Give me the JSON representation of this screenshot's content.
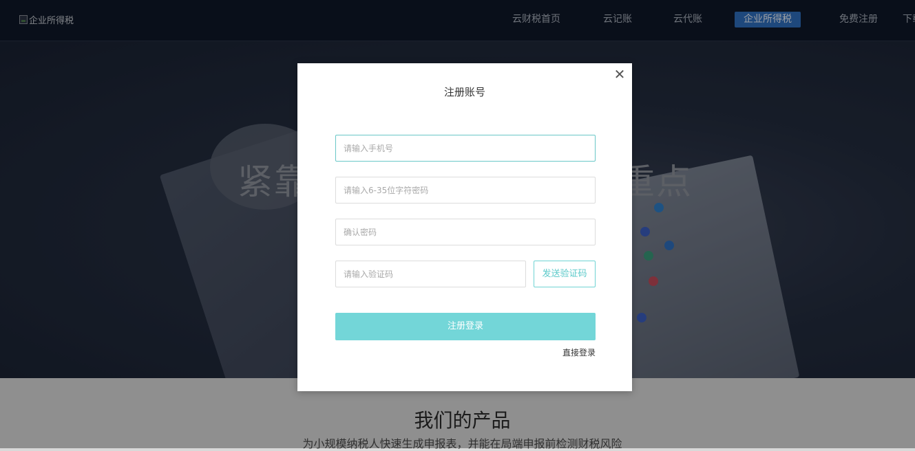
{
  "header": {
    "logo_alt": "企业所得税",
    "nav": [
      {
        "label": "云财税首页",
        "active": false
      },
      {
        "label": "云记账",
        "active": false
      },
      {
        "label": "云代账",
        "active": false
      },
      {
        "label": "企业所得税",
        "active": true
      },
      {
        "label": "免费注册",
        "active": false
      },
      {
        "label": "下载",
        "active": false
      }
    ]
  },
  "hero": {
    "headline_left": "紧靠",
    "headline_right": "重点"
  },
  "products": {
    "title": "我们的产品",
    "subtitle": "为小规模纳税人快速生成申报表，并能在局端申报前检测财税风险"
  },
  "modal": {
    "title": "注册账号",
    "close_icon": "close-icon",
    "phone_placeholder": "请输入手机号",
    "password_placeholder": "请输入6-35位字符密码",
    "confirm_placeholder": "确认密码",
    "code_placeholder": "请输入验证码",
    "send_code_label": "发送验证码",
    "submit_label": "注册登录",
    "direct_login_label": "直接登录"
  },
  "colors": {
    "accent": "#73d6d8",
    "nav_active": "#2f6fbf",
    "header_bg": "#0f1828"
  }
}
